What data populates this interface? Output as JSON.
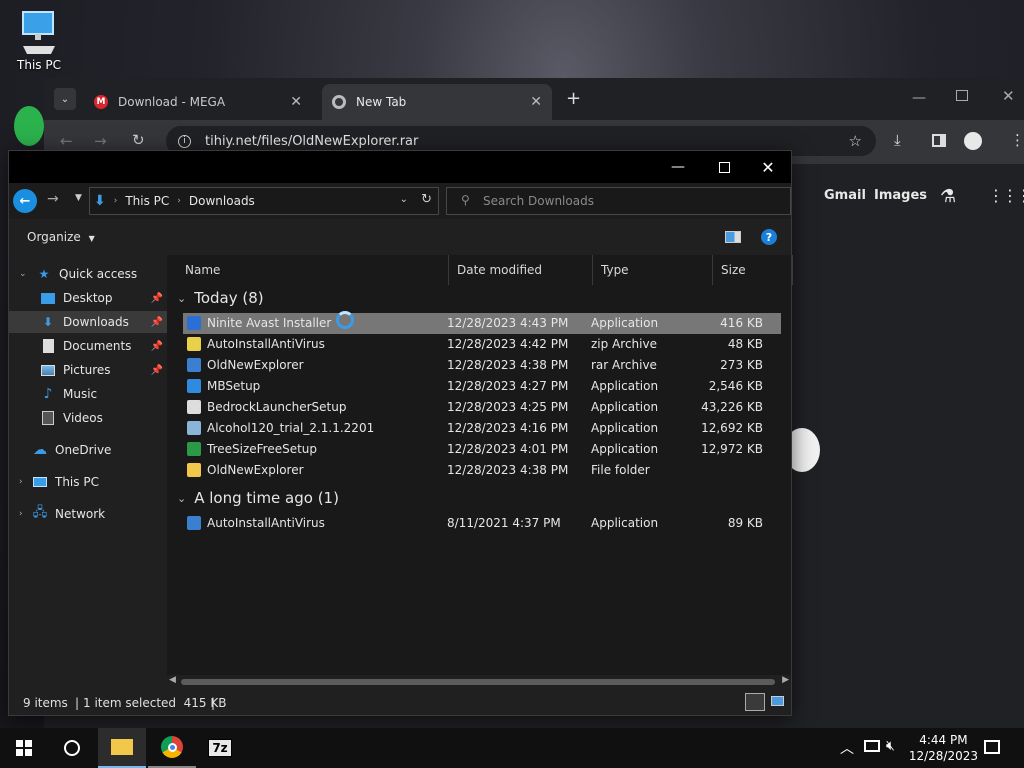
{
  "desktop": {
    "icon_label": "This PC"
  },
  "chrome": {
    "tabs": [
      {
        "label": "Download - MEGA"
      },
      {
        "label": "New Tab"
      }
    ],
    "url": "tihiy.net/files/OldNewExplorer.rar",
    "ntp": {
      "gmail": "Gmail",
      "images": "Images"
    }
  },
  "explorer": {
    "breadcrumb": [
      "This PC",
      "Downloads"
    ],
    "search_placeholder": "Search Downloads",
    "organize_label": "Organize",
    "nav": {
      "quick_access": "Quick access",
      "items": [
        "Desktop",
        "Downloads",
        "Documents",
        "Pictures",
        "Music",
        "Videos"
      ],
      "onedrive": "OneDrive",
      "this_pc": "This PC",
      "network": "Network"
    },
    "columns": {
      "name": "Name",
      "date": "Date modified",
      "type": "Type",
      "size": "Size"
    },
    "groups": [
      {
        "label": "Today (8)",
        "rows": [
          {
            "name": "Ninite Avast Installer",
            "date": "12/28/2023 4:43 PM",
            "type": "Application",
            "size": "416 KB"
          },
          {
            "name": "AutoInstallAntiVirus",
            "date": "12/28/2023 4:42 PM",
            "type": "zip Archive",
            "size": "48 KB"
          },
          {
            "name": "OldNewExplorer",
            "date": "12/28/2023 4:38 PM",
            "type": "rar Archive",
            "size": "273 KB"
          },
          {
            "name": "MBSetup",
            "date": "12/28/2023 4:27 PM",
            "type": "Application",
            "size": "2,546 KB"
          },
          {
            "name": "BedrockLauncherSetup",
            "date": "12/28/2023 4:25 PM",
            "type": "Application",
            "size": "43,226 KB"
          },
          {
            "name": "Alcohol120_trial_2.1.1.2201",
            "date": "12/28/2023 4:16 PM",
            "type": "Application",
            "size": "12,692 KB"
          },
          {
            "name": "TreeSizeFreeSetup",
            "date": "12/28/2023 4:01 PM",
            "type": "Application",
            "size": "12,972 KB"
          },
          {
            "name": "OldNewExplorer",
            "date": "12/28/2023 4:38 PM",
            "type": "File folder",
            "size": ""
          }
        ]
      },
      {
        "label": "A long time ago (1)",
        "rows": [
          {
            "name": "AutoInstallAntiVirus",
            "date": "8/11/2021 4:37 PM",
            "type": "Application",
            "size": "89 KB"
          }
        ]
      }
    ],
    "status": {
      "count": "9 items",
      "selection": "1 item selected  415 KB",
      "separator": "|"
    }
  },
  "taskbar": {
    "time": "4:44 PM",
    "date": "12/28/2023",
    "app_7z": "7z"
  }
}
